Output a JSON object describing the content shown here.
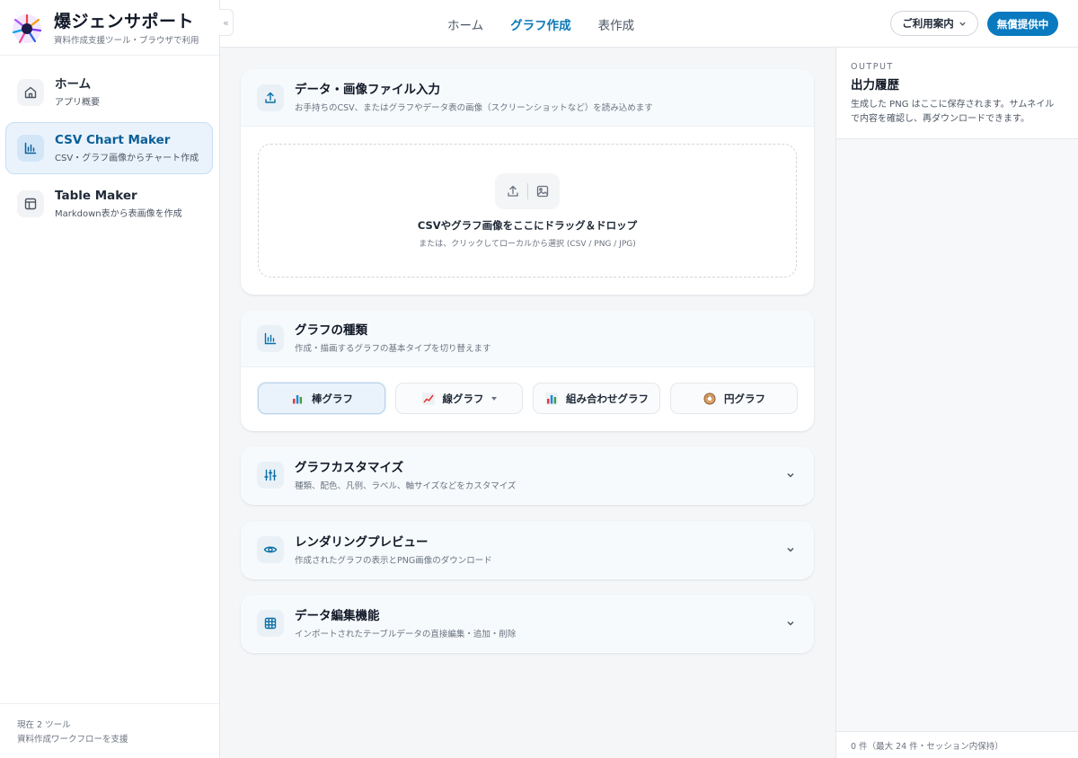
{
  "app": {
    "title": "爆ジェンサポート",
    "subtitle": "資料作成支援ツール・ブラウザで利用",
    "collapse_glyph": "«"
  },
  "sidebar": {
    "items": [
      {
        "title": "ホーム",
        "subtitle": "アプリ概要",
        "icon": "home-icon"
      },
      {
        "title": "CSV Chart Maker",
        "subtitle": "CSV・グラフ画像からチャート作成",
        "icon": "bar-chart-icon"
      },
      {
        "title": "Table Maker",
        "subtitle": "Markdown表から表画像を作成",
        "icon": "table-icon"
      }
    ],
    "footer_line1": "現在 2 ツール",
    "footer_line2": "資料作成ワークフローを支援"
  },
  "header": {
    "tabs": [
      "ホーム",
      "グラフ作成",
      "表作成"
    ],
    "active_tab": "グラフ作成",
    "guide_label": "ご利用案内",
    "free_label": "無償提供中"
  },
  "input_card": {
    "title": "データ・画像ファイル入力",
    "subtitle": "お手持ちのCSV、またはグラフやデータ表の画像（スクリーンショットなど）を読み込めます",
    "drop_main": "CSVやグラフ画像をここにドラッグ＆ドロップ",
    "drop_sub": "または、クリックしてローカルから選択 (CSV / PNG / JPG)"
  },
  "type_card": {
    "title": "グラフの種類",
    "subtitle": "作成・描画するグラフの基本タイプを切り替えます",
    "types": [
      {
        "label": "棒グラフ",
        "icon": "bar-chart-emoji-icon"
      },
      {
        "label": "線グラフ",
        "icon": "line-chart-emoji-icon"
      },
      {
        "label": "組み合わせグラフ",
        "icon": "combo-chart-emoji-icon"
      },
      {
        "label": "円グラフ",
        "icon": "donut-emoji-icon"
      }
    ],
    "active_type": "棒グラフ"
  },
  "customize_card": {
    "title": "グラフカスタマイズ",
    "subtitle": "種類、配色、凡例、ラベル、軸サイズなどをカスタマイズ"
  },
  "preview_card": {
    "title": "レンダリングプレビュー",
    "subtitle": "作成されたグラフの表示とPNG画像のダウンロード"
  },
  "edit_card": {
    "title": "データ編集機能",
    "subtitle": "インポートされたテーブルデータの直接編集・追加・削除"
  },
  "output_panel": {
    "overline": "OUTPUT",
    "title": "出力履歴",
    "description": "生成した PNG はここに保存されます。サムネイルで内容を確認し、再ダウンロードできます。",
    "footer": "0 件（最大 24 件・セッション内保持）"
  },
  "colors": {
    "accent": "#0a7ac0",
    "active_nav_bg": "#eaf3fc",
    "page_bg": "#f4f6f8"
  }
}
